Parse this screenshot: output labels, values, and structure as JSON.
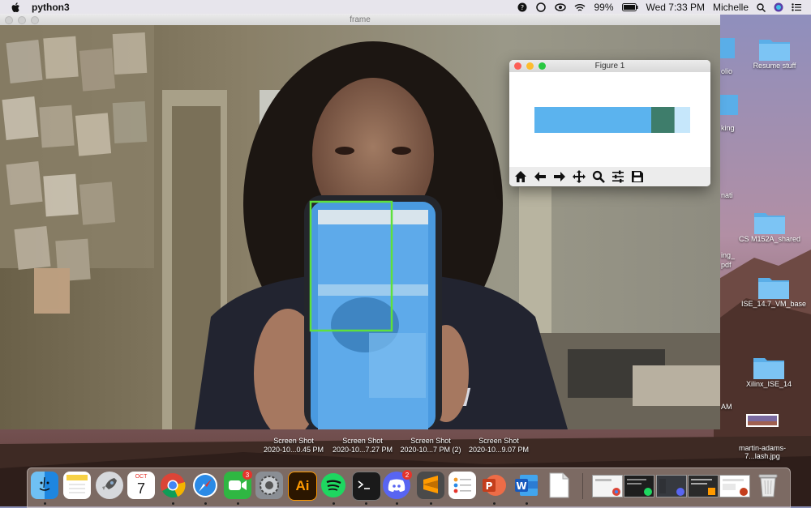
{
  "menubar": {
    "app_name": "python3",
    "battery": "99%",
    "datetime": "Wed 7:33 PM",
    "user": "Michelle"
  },
  "frame_window": {
    "title": "frame"
  },
  "figure_window": {
    "title": "Figure 1",
    "toolbar": [
      "home-icon",
      "back-arrow-icon",
      "forward-arrow-icon",
      "pan-icon",
      "zoom-icon",
      "configure-subplots-icon",
      "save-icon"
    ]
  },
  "chart_data": {
    "type": "bar",
    "orientation": "horizontal-stacked",
    "segments": [
      {
        "value": 0.75,
        "color": "#5bb3ee"
      },
      {
        "value": 0.15,
        "color": "#3e7d6b"
      },
      {
        "value": 0.1,
        "color": "#c6e7fb"
      }
    ],
    "grid": false,
    "axes": false
  },
  "desktop": {
    "icons": [
      {
        "label": "Resume stuff"
      },
      {
        "label": "CS M152A_shared"
      },
      {
        "label": "ISE_14.7_VM_base"
      },
      {
        "label": "Xilinx_ISE_14"
      },
      {
        "label": "martin-adams-7...lash.jpg"
      }
    ],
    "partial_labels": [
      "olio",
      "king",
      "nati",
      "ing_",
      "pdf",
      "AM"
    ]
  },
  "screenshots": [
    {
      "line1": "Screen Shot",
      "line2": "2020-10...0.45 PM"
    },
    {
      "line1": "Screen Shot",
      "line2": "2020-10...7.27 PM"
    },
    {
      "line1": "Screen Shot",
      "line2": "2020-10...7 PM (2)"
    },
    {
      "line1": "Screen Shot",
      "line2": "2020-10...9.07 PM"
    }
  ],
  "dock": {
    "apps": [
      "Finder",
      "Notes",
      "Launchpad",
      "Calendar",
      "Chrome",
      "Safari",
      "FaceTime",
      "System Preferences",
      "Illustrator",
      "Spotify",
      "Terminal",
      "Discord",
      "Sublime Text",
      "Reminders",
      "PowerPoint",
      "Word",
      "Document"
    ],
    "calendar": {
      "month": "OCT",
      "day": "7"
    },
    "badges": {
      "FaceTime": "3",
      "Discord": "2"
    },
    "illustrator_label": "Ai",
    "colors": {
      "accent": "#e5342c"
    }
  }
}
